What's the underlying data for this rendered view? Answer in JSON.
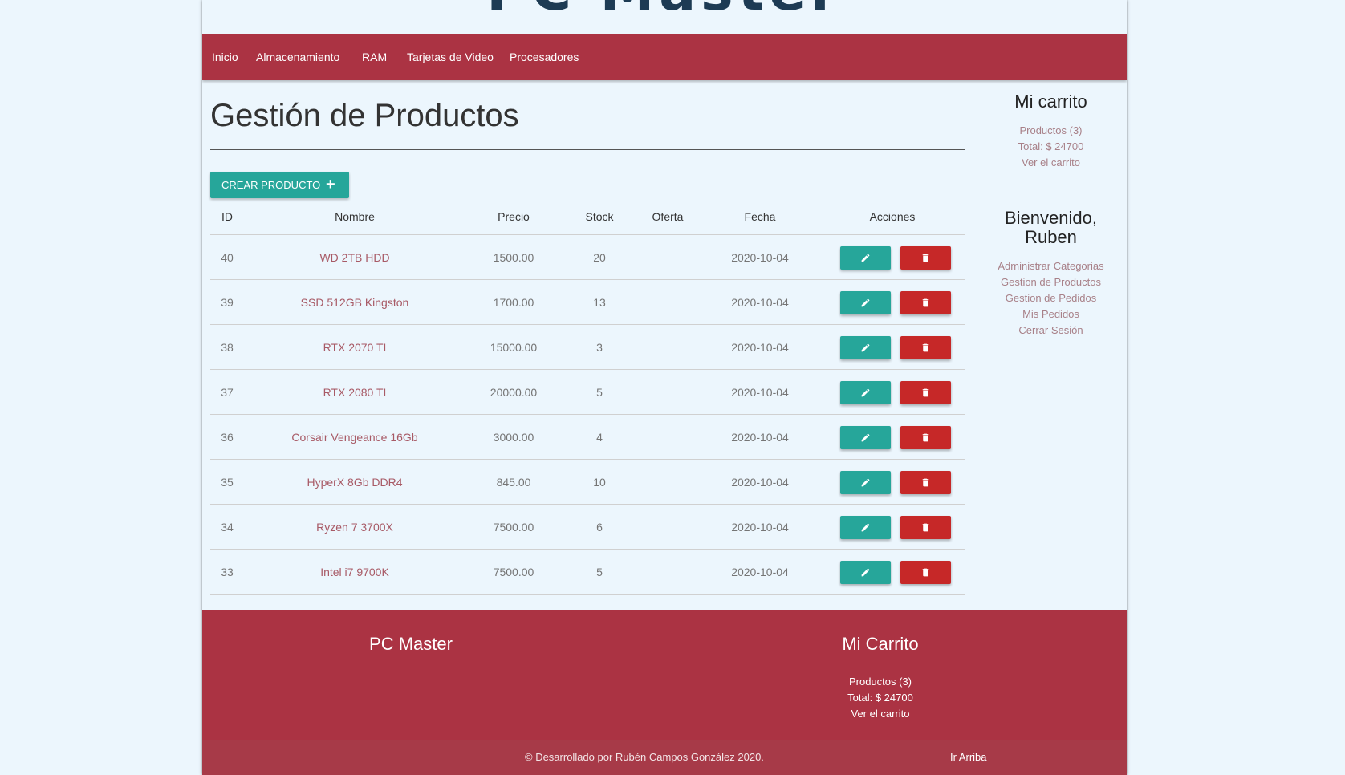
{
  "brand": {
    "logo": "PC Master"
  },
  "nav": {
    "items": [
      {
        "label": "Inicio"
      },
      {
        "label": "Almacenamiento"
      },
      {
        "label": "RAM"
      },
      {
        "label": "Tarjetas de Video"
      },
      {
        "label": "Procesadores"
      }
    ]
  },
  "main": {
    "title": "Gestión de Productos",
    "create_button": "CREAR PRODUCTO",
    "create_icon": "plus-icon",
    "columns": [
      "ID",
      "Nombre",
      "Precio",
      "Stock",
      "Oferta",
      "Fecha",
      "Acciones"
    ],
    "rows": [
      {
        "id": "40",
        "nombre": "WD 2TB HDD",
        "precio": "1500.00",
        "stock": "20",
        "oferta": "",
        "fecha": "2020-10-04"
      },
      {
        "id": "39",
        "nombre": "SSD 512GB Kingston",
        "precio": "1700.00",
        "stock": "13",
        "oferta": "",
        "fecha": "2020-10-04"
      },
      {
        "id": "38",
        "nombre": "RTX 2070 TI",
        "precio": "15000.00",
        "stock": "3",
        "oferta": "",
        "fecha": "2020-10-04"
      },
      {
        "id": "37",
        "nombre": "RTX 2080 TI",
        "precio": "20000.00",
        "stock": "5",
        "oferta": "",
        "fecha": "2020-10-04"
      },
      {
        "id": "36",
        "nombre": "Corsair Vengeance 16Gb",
        "precio": "3000.00",
        "stock": "4",
        "oferta": "",
        "fecha": "2020-10-04"
      },
      {
        "id": "35",
        "nombre": "HyperX 8Gb DDR4",
        "precio": "845.00",
        "stock": "10",
        "oferta": "",
        "fecha": "2020-10-04"
      },
      {
        "id": "34",
        "nombre": "Ryzen 7 3700X",
        "precio": "7500.00",
        "stock": "6",
        "oferta": "",
        "fecha": "2020-10-04"
      },
      {
        "id": "33",
        "nombre": "Intel i7 9700K",
        "precio": "7500.00",
        "stock": "5",
        "oferta": "",
        "fecha": "2020-10-04"
      }
    ],
    "edit_icon": "pencil-icon",
    "delete_icon": "trash-icon"
  },
  "sidebar": {
    "cart_title": "Mi carrito",
    "cart_products": "Productos (3)",
    "cart_total": "Total: $ 24700",
    "cart_link": "Ver el carrito",
    "welcome_line1": "Bienvenido,",
    "welcome_line2": "Ruben",
    "links": [
      "Administrar Categorias",
      "Gestion de Productos",
      "Gestion de Pedidos",
      "Mis Pedidos",
      "Cerrar Sesión"
    ]
  },
  "footer": {
    "brand": "PC Master",
    "cart_title": "Mi Carrito",
    "cart_products": "Productos (3)",
    "cart_total": "Total: $ 24700",
    "cart_link": "Ver el carrito",
    "copyright": "© Desarrollado por Rubén Campos González 2020.",
    "back_to_top": "Ir Arriba"
  },
  "colors": {
    "primary": "#ab3343",
    "teal": "#26a69a",
    "danger": "#c62828",
    "background": "#ecf6fd"
  }
}
